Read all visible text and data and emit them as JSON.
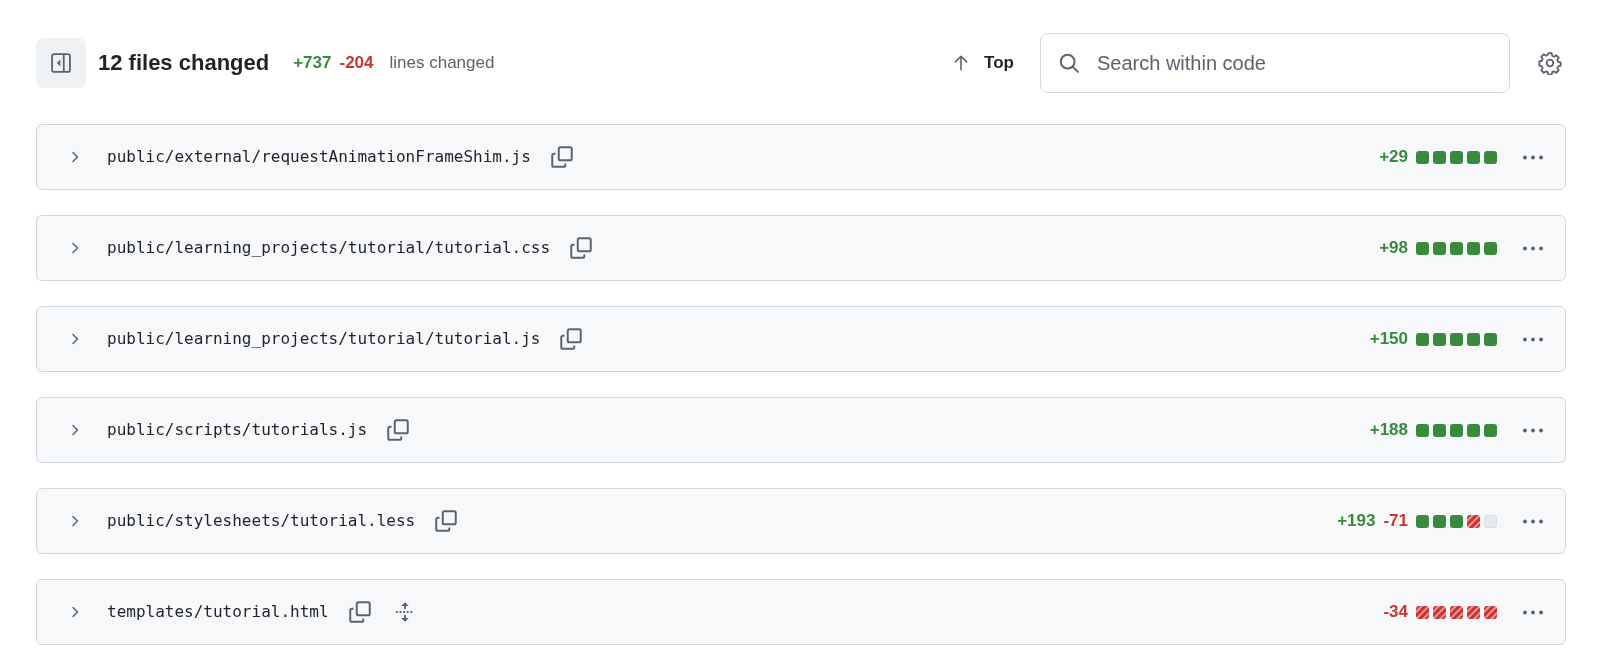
{
  "header": {
    "title": "12 files changed",
    "additions": "+737",
    "deletions": "-204",
    "note": "lines changed",
    "top_button": "Top",
    "search": {
      "placeholder": "Search within code"
    }
  },
  "files": [
    {
      "path": "public/external/requestAnimationFrameShim.js",
      "additions": "+29",
      "blocks": [
        {
          "kind": "added"
        },
        {
          "kind": "added"
        },
        {
          "kind": "added"
        },
        {
          "kind": "added"
        },
        {
          "kind": "added"
        }
      ],
      "expand_lines": false
    },
    {
      "path": "public/learning_projects/tutorial/tutorial.css",
      "additions": "+98",
      "blocks": [
        {
          "kind": "added"
        },
        {
          "kind": "added"
        },
        {
          "kind": "added"
        },
        {
          "kind": "added"
        },
        {
          "kind": "added"
        }
      ],
      "expand_lines": false
    },
    {
      "path": "public/learning_projects/tutorial/tutorial.js",
      "additions": "+150",
      "blocks": [
        {
          "kind": "added"
        },
        {
          "kind": "added"
        },
        {
          "kind": "added"
        },
        {
          "kind": "added"
        },
        {
          "kind": "added"
        }
      ],
      "expand_lines": false
    },
    {
      "path": "public/scripts/tutorials.js",
      "additions": "+188",
      "blocks": [
        {
          "kind": "added"
        },
        {
          "kind": "added"
        },
        {
          "kind": "added"
        },
        {
          "kind": "added"
        },
        {
          "kind": "added"
        }
      ],
      "expand_lines": false
    },
    {
      "path": "public/stylesheets/tutorial.less",
      "additions": "+193",
      "deletions": "-71",
      "blocks": [
        {
          "kind": "added"
        },
        {
          "kind": "added"
        },
        {
          "kind": "added"
        },
        {
          "kind": "deleted"
        },
        {
          "kind": "neutral"
        }
      ],
      "expand_lines": false
    },
    {
      "path": "templates/tutorial.html",
      "deletions": "-34",
      "blocks": [
        {
          "kind": "deleted"
        },
        {
          "kind": "deleted"
        },
        {
          "kind": "deleted"
        },
        {
          "kind": "deleted"
        },
        {
          "kind": "deleted"
        }
      ],
      "expand_lines": true
    }
  ]
}
